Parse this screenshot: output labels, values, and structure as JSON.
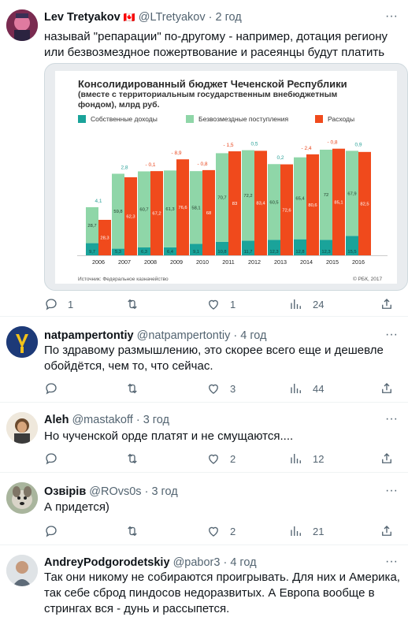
{
  "tweets": [
    {
      "name": "Lev Tretyakov",
      "badge": "🇨🇦",
      "handle": "@LTretyakov",
      "dot": "·",
      "time": "2 год",
      "text": "называй \"репарации\" по-другому - например, дотация региону или безвозмездное пожертвование и расеянцы будут платить",
      "replies": "1",
      "retweets": "",
      "likes": "1",
      "views": "24"
    },
    {
      "name": "natpampertontiy",
      "handle": "@natpampertontiy",
      "dot": "·",
      "time": "4 год",
      "text": "По здравому размышлению, это скорее всего еще и дешевле обойдётся, чем то, что сейчас.",
      "replies": "",
      "retweets": "",
      "likes": "3",
      "views": "44"
    },
    {
      "name": "Aleh",
      "handle": "@mastakoff",
      "dot": "·",
      "time": "3 год",
      "text": "Но чученской орде платят и не смущаются....",
      "replies": "",
      "retweets": "",
      "likes": "2",
      "views": "12"
    },
    {
      "name": "Озвірів",
      "handle": "@ROvs0s",
      "dot": "·",
      "time": "3 год",
      "text": "А придется)",
      "replies": "",
      "retweets": "",
      "likes": "2",
      "views": "21"
    },
    {
      "name": "AndreyPodgorodetskiy",
      "handle": "@pabor3",
      "dot": "·",
      "time": "4 год",
      "text": "Так они никому не собираются проигрывать. Для них и Америка, так себе сброд пиндосов недоразвитых. А Европа вообще в стрингах вся - дунь и рассыпется.",
      "replies": "",
      "retweets": "",
      "likes": "",
      "views": ""
    }
  ],
  "chart_data": {
    "type": "bar",
    "title": "Консолидированный бюджет Чеченской Республики",
    "subtitle": "(вместе с территориальным государственным внебюджетным фондом), млрд руб.",
    "categories": [
      "2006",
      "2007",
      "2008",
      "2009",
      "2010",
      "2011",
      "2012",
      "2013",
      "2014",
      "2015",
      "2016"
    ],
    "series": [
      {
        "name": "Собственные доходы",
        "color": "#1aa39a",
        "values": [
          9.7,
          5.3,
          6.3,
          6.4,
          9.1,
          10.8,
          11.7,
          12.3,
          12.8,
          12.3,
          15.5
        ]
      },
      {
        "name": "Безвозмездные поступления",
        "color": "#8fd6a8",
        "values": [
          28.7,
          59.8,
          60.7,
          61.3,
          58.1,
          70.7,
          72.2,
          60.5,
          65.4,
          72,
          67.9
        ]
      },
      {
        "name": "Расходы",
        "color": "#f04a1c",
        "values": [
          28.3,
          62.3,
          67.2,
          76.6,
          68,
          83,
          83.4,
          72.6,
          80.6,
          85.1,
          82.5
        ]
      }
    ],
    "balance": [
      "4,1",
      "2,8",
      "- 0,1",
      "- 8,9",
      "- 0,8",
      "- 1,5",
      "0,5",
      "0,2",
      "- 2,4",
      "- 0,8",
      "0,9"
    ],
    "source": "Источник: Федеральное казначейство",
    "credit": "© РБК, 2017",
    "ylim": [
      0,
      100
    ]
  },
  "colors": {
    "own": "#1aa39a",
    "grant": "#8fd6a8",
    "expense": "#f04a1c",
    "positive": "#2aa198",
    "negative": "#e8431a"
  }
}
